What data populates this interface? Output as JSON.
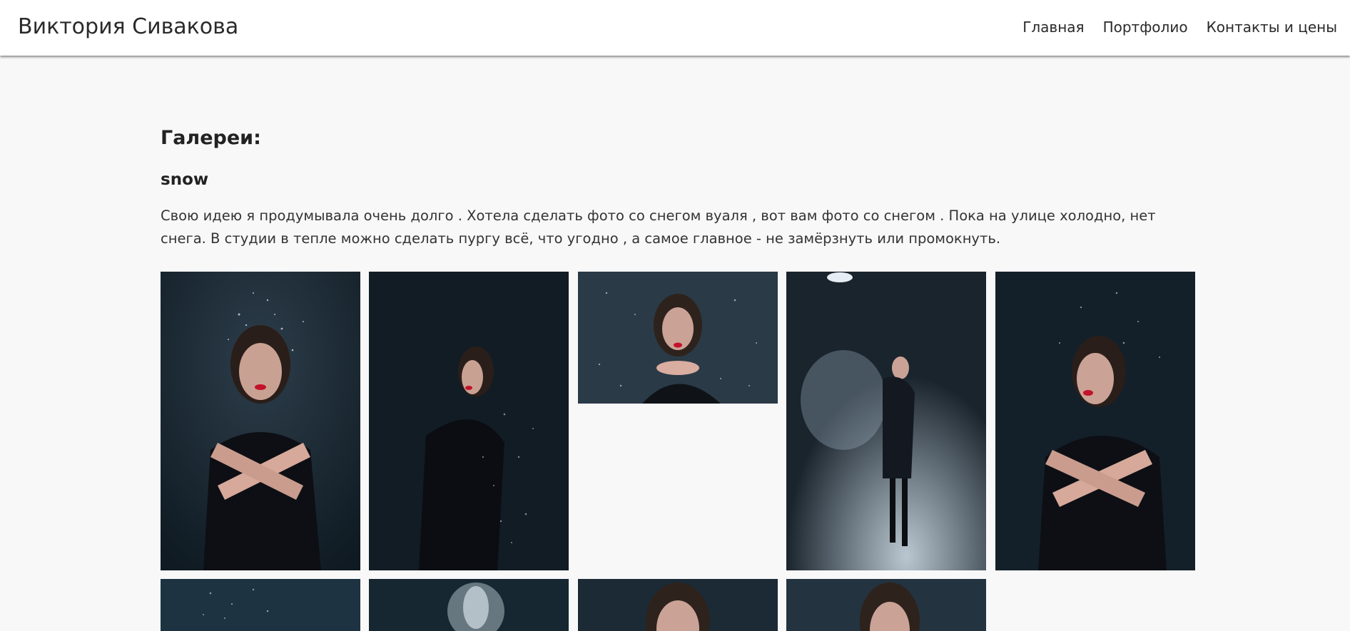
{
  "header": {
    "site_title": "Виктория Сивакова",
    "nav": [
      {
        "label": "Главная"
      },
      {
        "label": "Портфолио"
      },
      {
        "label": "Контакты и цены"
      }
    ]
  },
  "main": {
    "heading": "Галереи:",
    "gallery": {
      "name": "snow",
      "description": "Свою идею я продумывала очень долго . Хотела сделать фото со снегом вуаля , вот вам фото со снегом . Пока на улице холодно, нет снега. В студии в тепле можно сделать пургу всё, что угодно , а самое главное - не замёрзнуть или промокнуть.",
      "photos": [
        {
          "name": "photo-1",
          "subject": "woman-arms-crossed-snow"
        },
        {
          "name": "photo-2",
          "subject": "woman-side-view-snow"
        },
        {
          "name": "photo-3",
          "subject": "woman-blowing-snow-landscape"
        },
        {
          "name": "photo-4",
          "subject": "woman-standing-spotlight-snow"
        },
        {
          "name": "photo-5",
          "subject": "woman-arms-crossed-closeup"
        },
        {
          "name": "photo-6",
          "subject": "falling-snow"
        },
        {
          "name": "photo-7",
          "subject": "snow-burst"
        },
        {
          "name": "photo-8",
          "subject": "woman-face-snow"
        },
        {
          "name": "photo-9",
          "subject": "woman-portrait-snow"
        }
      ]
    }
  },
  "colors": {
    "page_background": "#f8f8f8",
    "header_background": "#ffffff",
    "photo_dark": "#16222b",
    "lips_accent": "#c4122a"
  }
}
